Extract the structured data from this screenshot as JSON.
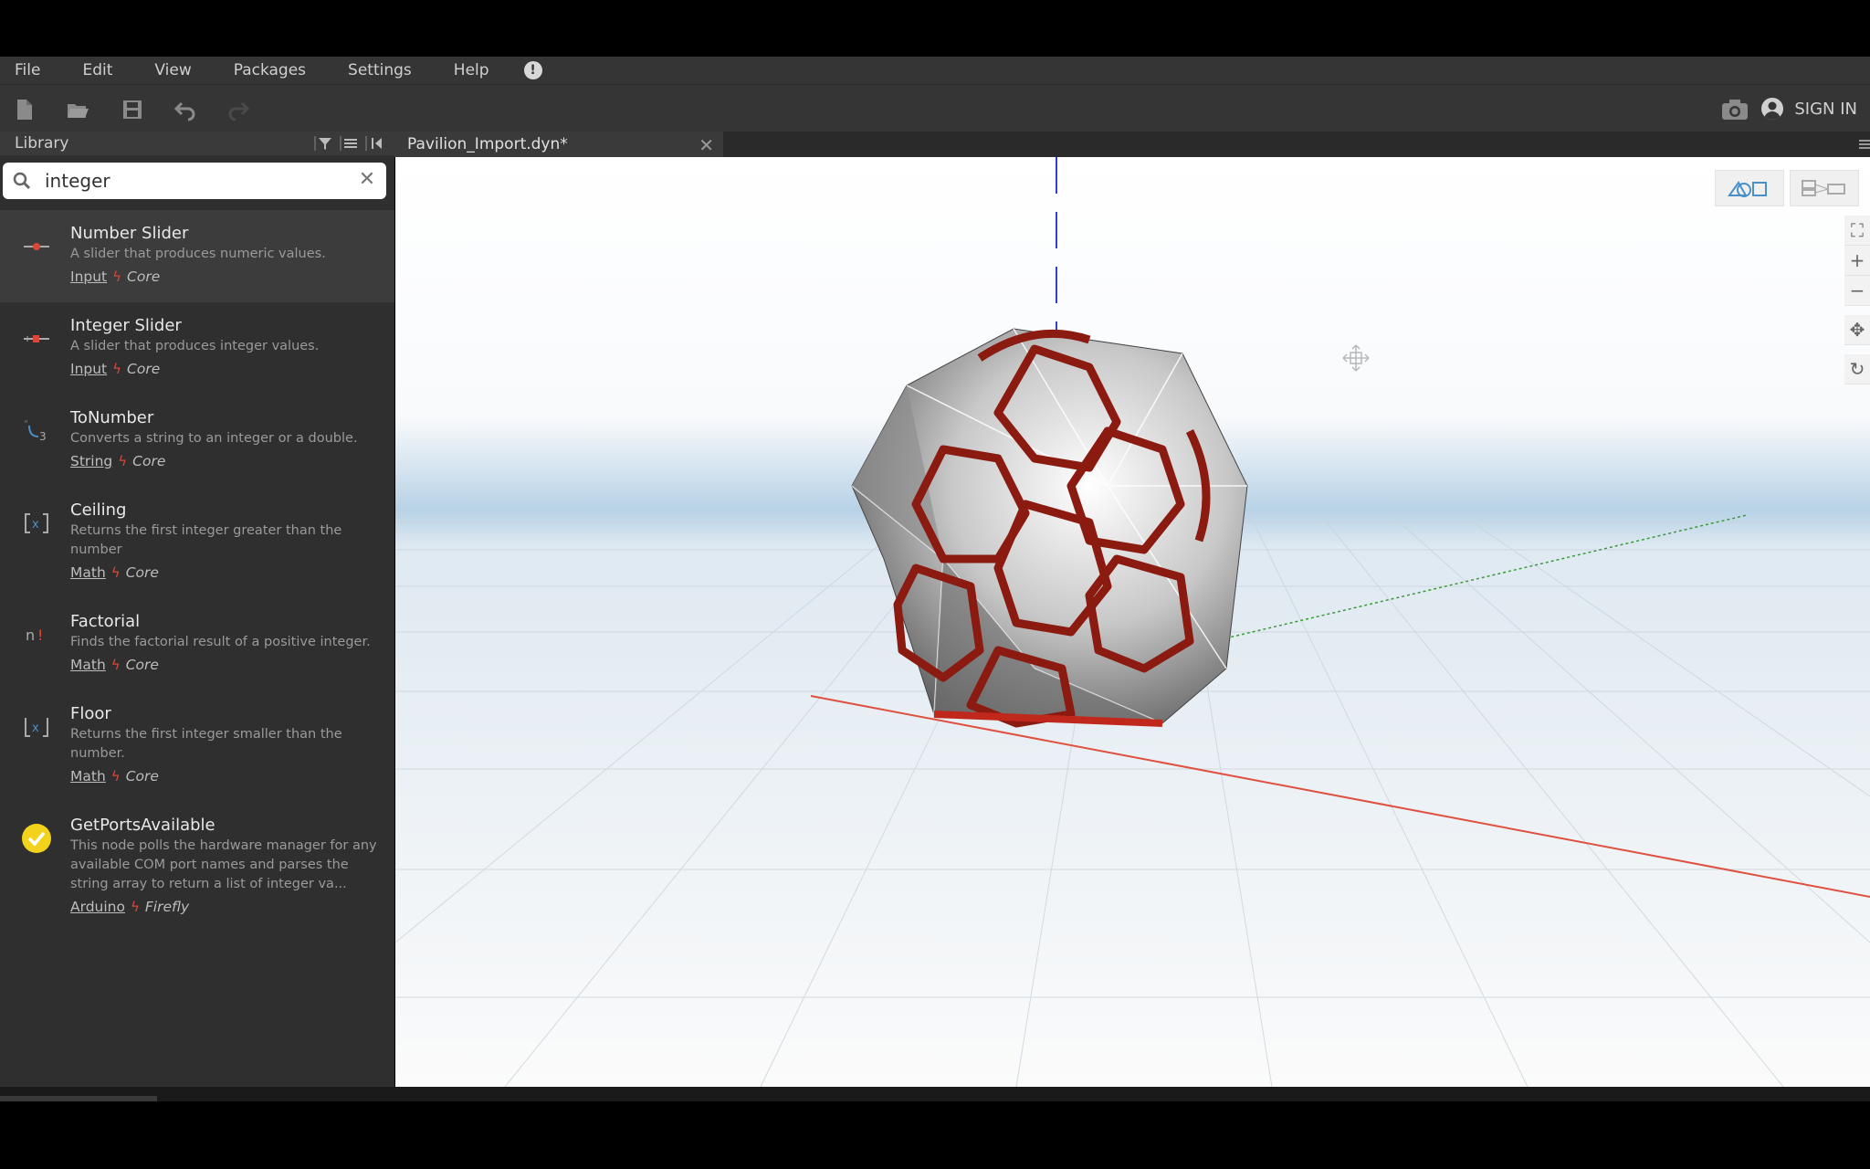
{
  "menu": [
    "File",
    "Edit",
    "View",
    "Packages",
    "Settings",
    "Help"
  ],
  "toolbar": {
    "sign_in": "SIGN IN"
  },
  "library": {
    "title": "Library",
    "search_value": "integer",
    "results": [
      {
        "name": "Number Slider",
        "desc": "A slider that produces numeric values.",
        "category": "Input",
        "lib": "Core",
        "icon": "slider-icon"
      },
      {
        "name": "Integer Slider",
        "desc": "A slider that produces integer values.",
        "category": "Input",
        "lib": "Core",
        "icon": "integer-slider-icon"
      },
      {
        "name": "ToNumber",
        "desc": "Converts a string to an integer or a double.",
        "category": "String",
        "lib": "Core",
        "icon": "to-number-icon"
      },
      {
        "name": "Ceiling",
        "desc": "Returns the first integer greater than the number",
        "category": "Math",
        "lib": "Core",
        "icon": "ceiling-icon"
      },
      {
        "name": "Factorial",
        "desc": "Finds the factorial result of a positive integer.",
        "category": "Math",
        "lib": "Core",
        "icon": "factorial-icon"
      },
      {
        "name": "Floor",
        "desc": "Returns the first integer smaller than the number.",
        "category": "Math",
        "lib": "Core",
        "icon": "floor-icon"
      },
      {
        "name": "GetPortsAvailable",
        "desc": "This node polls the hardware manager for any available COM port names and parses the string array to return a list of integer va...",
        "category": "Arduino",
        "lib": "Firefly",
        "icon": "check-circle-icon"
      }
    ]
  },
  "tab": {
    "title": "Pavilion_Import.dyn*"
  },
  "colors": {
    "accent_blue": "#4a90c8",
    "bolt_red": "#d9473a",
    "axis_red": "#e05040",
    "axis_green": "#3a9a3a",
    "axis_blue": "#3040d0"
  }
}
